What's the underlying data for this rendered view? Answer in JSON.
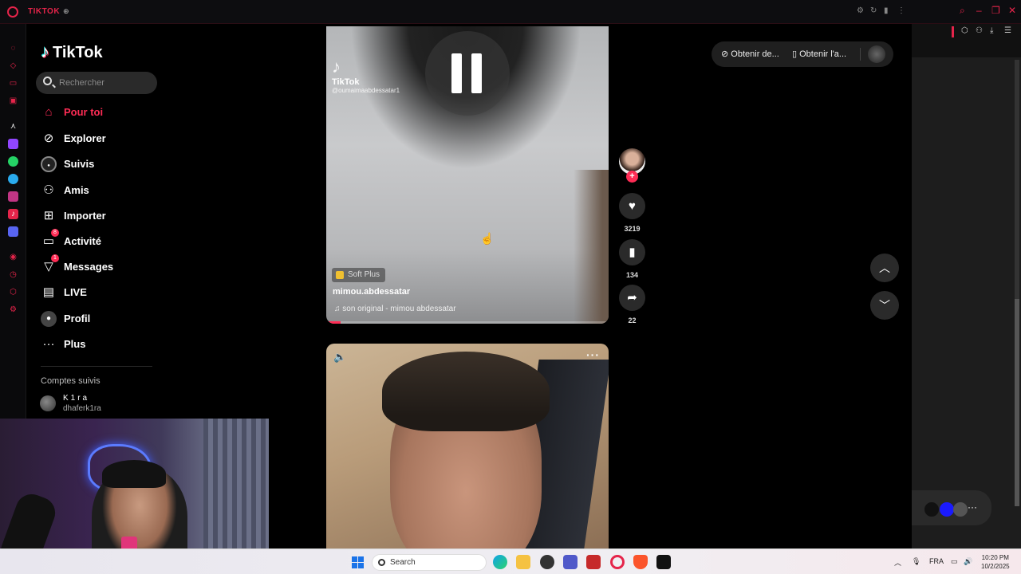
{
  "browser": {
    "title": "TIKTOK",
    "lock_icon": "lock-icon"
  },
  "nav": {
    "logo": "TikTok",
    "search_placeholder": "Rechercher",
    "items": [
      {
        "label": "Pour toi",
        "icon": "home-icon",
        "active": true
      },
      {
        "label": "Explorer",
        "icon": "compass-icon"
      },
      {
        "label": "Suivis",
        "icon": "following-avatar-icon"
      },
      {
        "label": "Amis",
        "icon": "friends-icon"
      },
      {
        "label": "Importer",
        "icon": "upload-icon"
      },
      {
        "label": "Activité",
        "icon": "activity-icon",
        "badge": "8"
      },
      {
        "label": "Messages",
        "icon": "messages-icon",
        "badge": "1"
      },
      {
        "label": "LIVE",
        "icon": "live-icon"
      },
      {
        "label": "Profil",
        "icon": "profile-icon"
      },
      {
        "label": "Plus",
        "icon": "more-icon"
      }
    ],
    "following_heading": "Comptes suivis",
    "following": [
      {
        "name": "K1ra",
        "username": "dhaferk1ra"
      }
    ]
  },
  "video1": {
    "watermark_logo": "TikTok",
    "watermark_user": "@oumaimaabdessatar1",
    "tag": "Soft Plus",
    "author": "mimou.abdessatar",
    "sound": "son original - mimou abdessatar",
    "progress": 0.05,
    "likes": "3219",
    "saves": "134",
    "shares": "22"
  },
  "header": {
    "get_coins": "Obtenir de...",
    "get_app": "Obtenir l'a..."
  },
  "taskbar": {
    "search": "Search",
    "lang": "FRA",
    "time": "10:20 PM",
    "date": "10/2/2025"
  },
  "colors": {
    "accent": "#fe2c55",
    "opera_red": "#e5244a"
  }
}
